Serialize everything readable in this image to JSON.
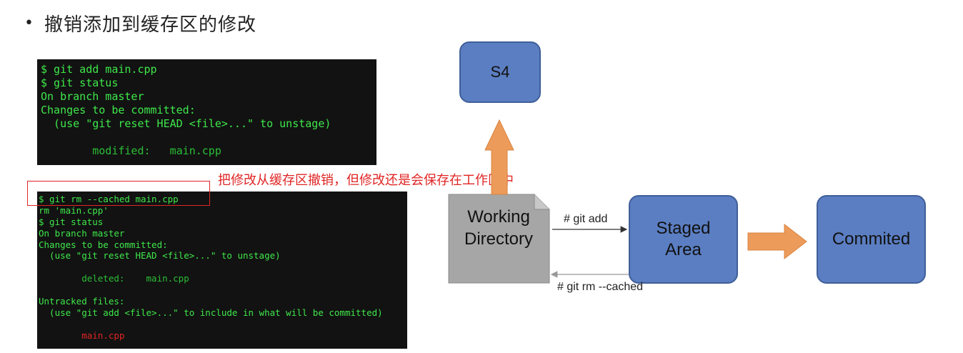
{
  "slide": {
    "bullet": "•",
    "title": "撤销添加到缓存区的修改"
  },
  "terminal1": {
    "lines": [
      {
        "text": "$ git add main.cpp",
        "color": "g"
      },
      {
        "text": "$ git status",
        "color": "g"
      },
      {
        "text": "On branch master",
        "color": "g"
      },
      {
        "text": "Changes to be committed:",
        "color": "g"
      },
      {
        "text": "  (use \"git reset HEAD <file>...\" to unstage)",
        "color": "g"
      },
      {
        "text": "",
        "color": "g"
      },
      {
        "text": "        modified:   main.cpp",
        "color": "gd"
      }
    ]
  },
  "terminal2": {
    "lines": [
      {
        "text": "$ git rm --cached main.cpp",
        "color": "g"
      },
      {
        "text": "rm 'main.cpp'",
        "color": "g"
      },
      {
        "text": "$ git status",
        "color": "g"
      },
      {
        "text": "On branch master",
        "color": "g"
      },
      {
        "text": "Changes to be committed:",
        "color": "g"
      },
      {
        "text": "  (use \"git reset HEAD <file>...\" to unstage)",
        "color": "g"
      },
      {
        "text": "",
        "color": "g"
      },
      {
        "text": "        deleted:    main.cpp",
        "color": "gd"
      },
      {
        "text": "",
        "color": "g"
      },
      {
        "text": "Untracked files:",
        "color": "g"
      },
      {
        "text": "  (use \"git add <file>...\" to include in what will be committed)",
        "color": "g"
      },
      {
        "text": "",
        "color": "g"
      },
      {
        "text": "        main.cpp",
        "color": "r"
      }
    ]
  },
  "annotation": "把修改从缓存区撤销，但修改还是会保存在工作区中",
  "diagram": {
    "s4": "S4",
    "working_directory": "Working\nDirectory",
    "staged_area": "Staged\nArea",
    "commited": "Commited",
    "edge_add": "# git add",
    "edge_rm": "# git rm --cached"
  },
  "colors": {
    "node_fill": "#5b7ec2",
    "node_stroke": "#3f5f99",
    "arrow_orange": "#ed9b5a",
    "doc_gray": "#a6a6a6",
    "annotation_red": "#e02525",
    "terminal_bg": "#121212",
    "terminal_green": "#3ee84a"
  }
}
